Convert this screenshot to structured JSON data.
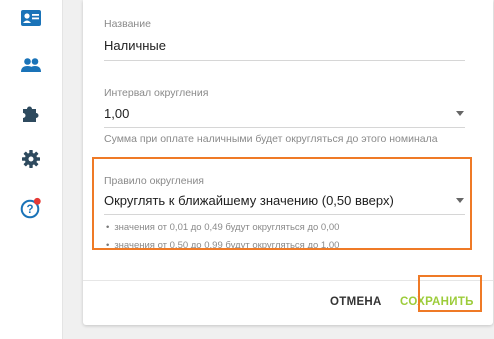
{
  "colors": {
    "accent": "#1a73b8",
    "save_green": "#9ccc3a",
    "highlight": "#ef7a26",
    "badge_red": "#e53935"
  },
  "sidebar": {
    "icons": [
      "contact-card-icon",
      "people-icon",
      "puzzle-icon",
      "gear-icon",
      "help-badge-icon"
    ]
  },
  "form": {
    "name": {
      "label": "Название",
      "value": "Наличные"
    },
    "interval": {
      "label": "Интервал округления",
      "value": "1,00",
      "hint": "Сумма при оплате наличными будет округляться до этого номинала"
    },
    "rule": {
      "label": "Правило округления",
      "value": "Округлять к ближайшему значению (0,50 вверх)",
      "bullets": [
        "значения от 0,01 до 0,49 будут округляться до 0,00",
        "значения от 0,50 до 0,99 будут округляться до 1,00"
      ]
    }
  },
  "actions": {
    "cancel": "ОТМЕНА",
    "save": "СОХРАНИТЬ"
  }
}
